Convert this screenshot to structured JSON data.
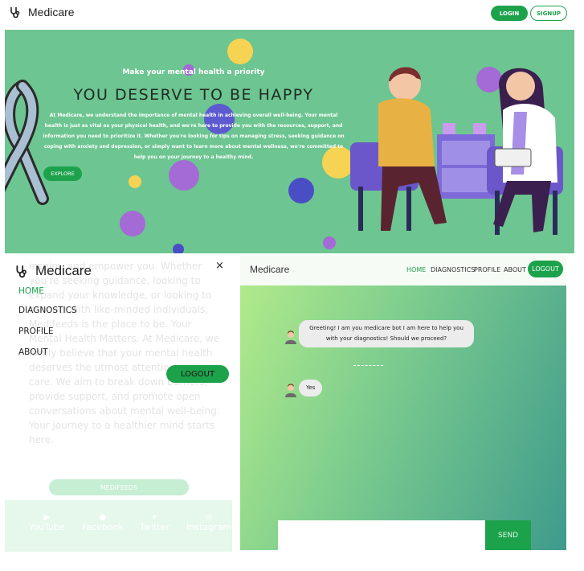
{
  "topnav": {
    "brand": "Medicare",
    "login": "LOGIN",
    "signup": "SIGNUP"
  },
  "hero": {
    "subtitle": "Make your mental health a priority",
    "title": "YOU DESERVE TO BE HAPPY",
    "text": "At Medicare, we understand the importance of mental health in achieving overall well-being. Your mental health is just as vital as your physical health, and we're here to provide you with the resources, support, and information you need to prioritize it. Whether you're looking for tips on managing stress, seeking guidance on coping with anxiety and depression, or simply want to learn more about mental wellness, we're committed to help you on your journey to a healthy mind.",
    "explore": "EXPLORE"
  },
  "left_panel": {
    "ghost_text": "inspire, and empower you. Whether you're seeking guidance, looking to expand your knowledge, or looking to connect with like-minded individuals, Medifeeds is the place to be. Your Mental Health Matters. At Medicare, we firmly believe that your mental health deserves the utmost attention and care. We aim to break down barriers, provide support, and promote open conversations about mental well-being. Your journey to a healthier mind starts here.",
    "ghost_button": "MEDIFEEDS",
    "footer": [
      {
        "label": "YouTube",
        "icon": "youtube-icon"
      },
      {
        "label": "Facebook",
        "icon": "facebook-icon"
      },
      {
        "label": "Twitter",
        "icon": "twitter-icon"
      },
      {
        "label": "Instagram",
        "icon": "instagram-icon"
      }
    ],
    "menu": {
      "brand": "Medicare",
      "close": "×",
      "items": [
        "HOME",
        "DIAGNOSTICS",
        "PROFILE",
        "ABOUT"
      ],
      "logout": "LOGOUT"
    }
  },
  "chat": {
    "brand": "Medicare",
    "nav": [
      "HOME",
      "DIAGNOSTICS",
      "PROFILE",
      "ABOUT"
    ],
    "logout": "LOGOUT",
    "messages": [
      {
        "sender": "bot",
        "text": "Greeting! I am you medicare bot I am here to help you with your diagnostics! Should we proceed?"
      },
      {
        "sender": "user",
        "text": "Yes"
      }
    ],
    "input_placeholder": "",
    "send": "SEND"
  },
  "colors": {
    "accent": "#1da24c",
    "hero_bg": "#6dc591"
  }
}
